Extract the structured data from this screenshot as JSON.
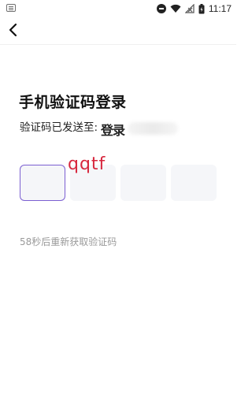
{
  "status_bar": {
    "time": "11:17",
    "icons": [
      "keyboard-icon",
      "dnd-icon",
      "wifi-icon",
      "signal-icon",
      "battery-icon"
    ]
  },
  "header": {
    "back_icon": "chevron-left-icon"
  },
  "title": "手机验证码登录",
  "sent_info": "验证码已发送至:",
  "overlay_text": "登录",
  "code_boxes": [
    "",
    "",
    "",
    ""
  ],
  "handwritten_annotation": "qqtf",
  "resend": "58秒后重新获取验证码",
  "colors": {
    "accent": "#7b5fd1",
    "box_bg": "#f5f6f9",
    "annotation": "#d7263d",
    "muted_text": "#9a9a9a"
  }
}
